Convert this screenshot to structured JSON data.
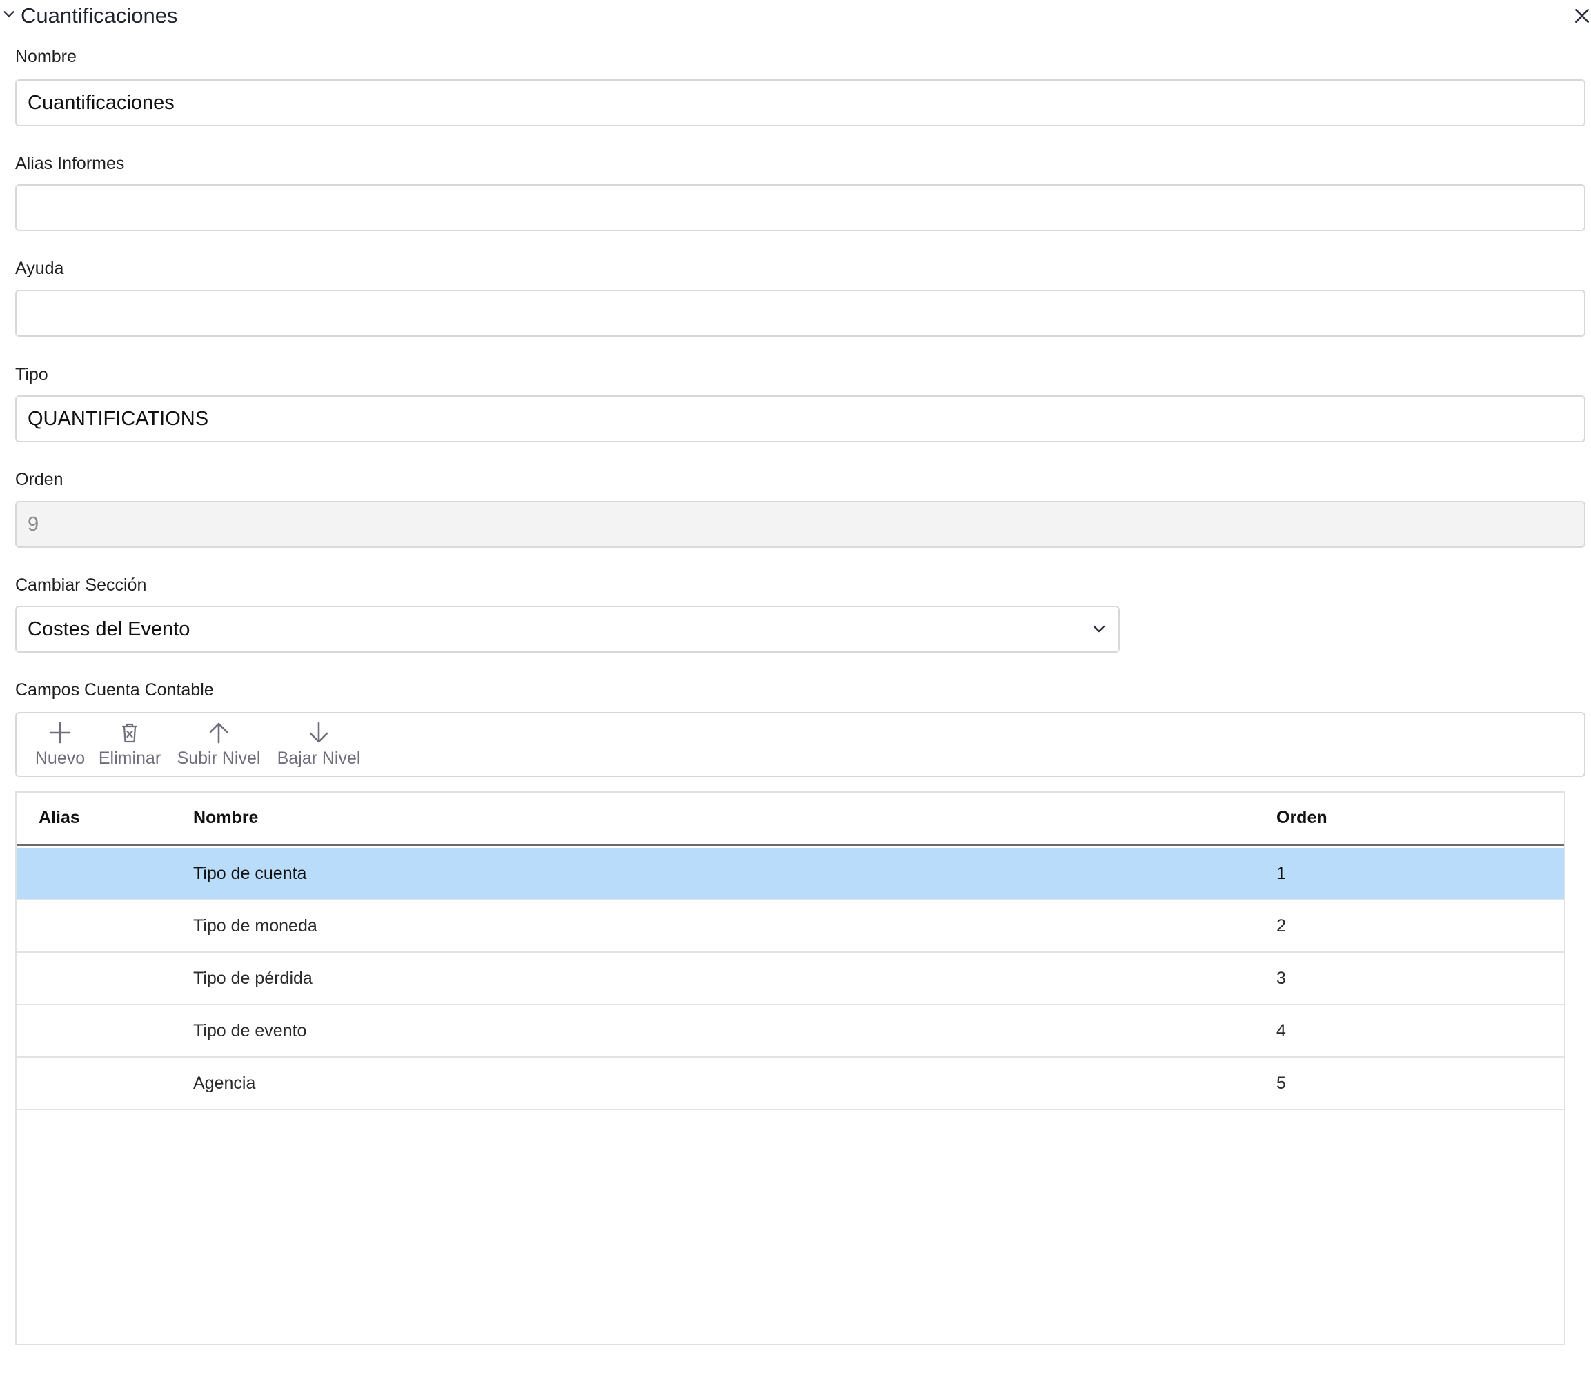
{
  "panel": {
    "title": "Cuantificaciones"
  },
  "form": {
    "nombre": {
      "label": "Nombre",
      "value": "Cuantificaciones"
    },
    "alias_informes": {
      "label": "Alias Informes",
      "value": ""
    },
    "ayuda": {
      "label": "Ayuda",
      "value": ""
    },
    "tipo": {
      "label": "Tipo",
      "value": "QUANTIFICATIONS"
    },
    "orden": {
      "label": "Orden",
      "value": "9"
    },
    "cambiar_seccion": {
      "label": "Cambiar Sección",
      "value": "Costes del Evento"
    },
    "campos_cuenta_contable": {
      "label": "Campos Cuenta Contable"
    }
  },
  "toolbar": {
    "nuevo": "Nuevo",
    "eliminar": "Eliminar",
    "subir_nivel": "Subir Nivel",
    "bajar_nivel": "Bajar Nivel"
  },
  "grid": {
    "columns": [
      "Alias",
      "Nombre",
      "Orden"
    ],
    "rows": [
      {
        "alias": "",
        "nombre": "Tipo de cuenta",
        "orden": "1",
        "selected": true
      },
      {
        "alias": "",
        "nombre": "Tipo de moneda",
        "orden": "2",
        "selected": false
      },
      {
        "alias": "",
        "nombre": "Tipo de pérdida",
        "orden": "3",
        "selected": false
      },
      {
        "alias": "",
        "nombre": "Tipo de evento",
        "orden": "4",
        "selected": false
      },
      {
        "alias": "",
        "nombre": "Agencia",
        "orden": "5",
        "selected": false
      }
    ]
  },
  "icons": {
    "collapse": "chevron-down-icon",
    "close": "close-icon",
    "select_caret": "chevron-down-icon",
    "nuevo": "plus-icon",
    "eliminar": "trash-icon",
    "subir_nivel": "arrow-up-icon",
    "bajar_nivel": "arrow-down-icon"
  },
  "colors": {
    "selected_row": "#b8dcfa",
    "toolbar_text": "#6e6e7c",
    "disabled_field_bg": "#f3f3f3",
    "border": "#d8d8d8"
  }
}
